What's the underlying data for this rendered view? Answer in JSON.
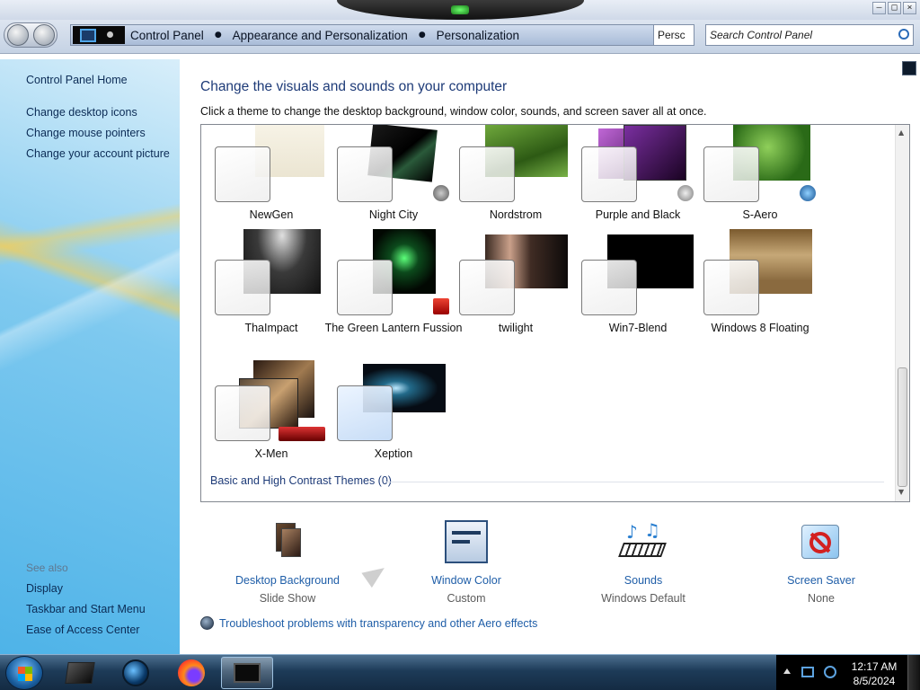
{
  "window": {
    "controls": [
      "–",
      "□",
      "×"
    ]
  },
  "address": {
    "crumbs": [
      "Control Panel",
      "Appearance and Personalization",
      "Personalization"
    ],
    "current_box": "Persc",
    "search_placeholder": "Search Control Panel"
  },
  "sidebar": {
    "home": "Control Panel Home",
    "links": [
      "Change desktop icons",
      "Change mouse pointers",
      "Change your account picture"
    ],
    "see_also_title": "See also",
    "see_also": [
      "Display",
      "Taskbar and Start Menu",
      "Ease of Access Center"
    ]
  },
  "main": {
    "title": "Change the visuals and sounds on your computer",
    "subtitle": "Click a theme to change the desktop background, window color, sounds, and screen saver all at once.",
    "themes": [
      {
        "name": "NewGen",
        "bg": "#f3efe3",
        "icon": null
      },
      {
        "name": "Night City",
        "bg": "#0b0b0b",
        "icon": "skull-icon"
      },
      {
        "name": "Nordstrom",
        "bg": "#5b8f2e",
        "icon": null
      },
      {
        "name": "Purple and Black",
        "bg": "#6a2a8f",
        "icon": "skull-icon"
      },
      {
        "name": "S-Aero",
        "bg": "#3f7a22",
        "icon": "windows-orb-icon"
      },
      {
        "name": "ThaImpact",
        "bg": "#2a2a2a",
        "icon": null
      },
      {
        "name": "The Green Lantern Fussion",
        "bg": "#071c0c",
        "icon": "lantern-badge-icon"
      },
      {
        "name": "twilight",
        "bg": "#1a1414",
        "icon": null
      },
      {
        "name": "Win7-Blend",
        "bg": "#000000",
        "icon": null
      },
      {
        "name": "Windows 8 Floating",
        "bg": "#a88b5e",
        "icon": null
      },
      {
        "name": "X-Men",
        "bg": "#3a2f2a",
        "icon": "xmen-logo-icon"
      },
      {
        "name": "Xeption",
        "bg": "#0a141e",
        "icon": null
      }
    ],
    "basic_link": "Basic and High Contrast Themes (0)",
    "options": [
      {
        "label": "Desktop Background",
        "value": "Slide Show",
        "icon": "slideshow-icon"
      },
      {
        "label": "Window Color",
        "value": "Custom",
        "icon": "window-color-icon"
      },
      {
        "label": "Sounds",
        "value": "Windows Default",
        "icon": "sounds-icon"
      },
      {
        "label": "Screen Saver",
        "value": "None",
        "icon": "screen-saver-icon"
      }
    ],
    "troubleshoot": "Troubleshoot problems with transparency and other Aero effects"
  },
  "taskbar": {
    "apps": [
      "explorer-icon",
      "media-icon",
      "firefox-icon",
      "control-panel-icon"
    ],
    "time": "12:17 AM",
    "date": "8/5/2024"
  },
  "colors": {
    "link": "#1f5ea8",
    "heading": "#1e3b78",
    "sidebar_text": "#0b2b55"
  }
}
